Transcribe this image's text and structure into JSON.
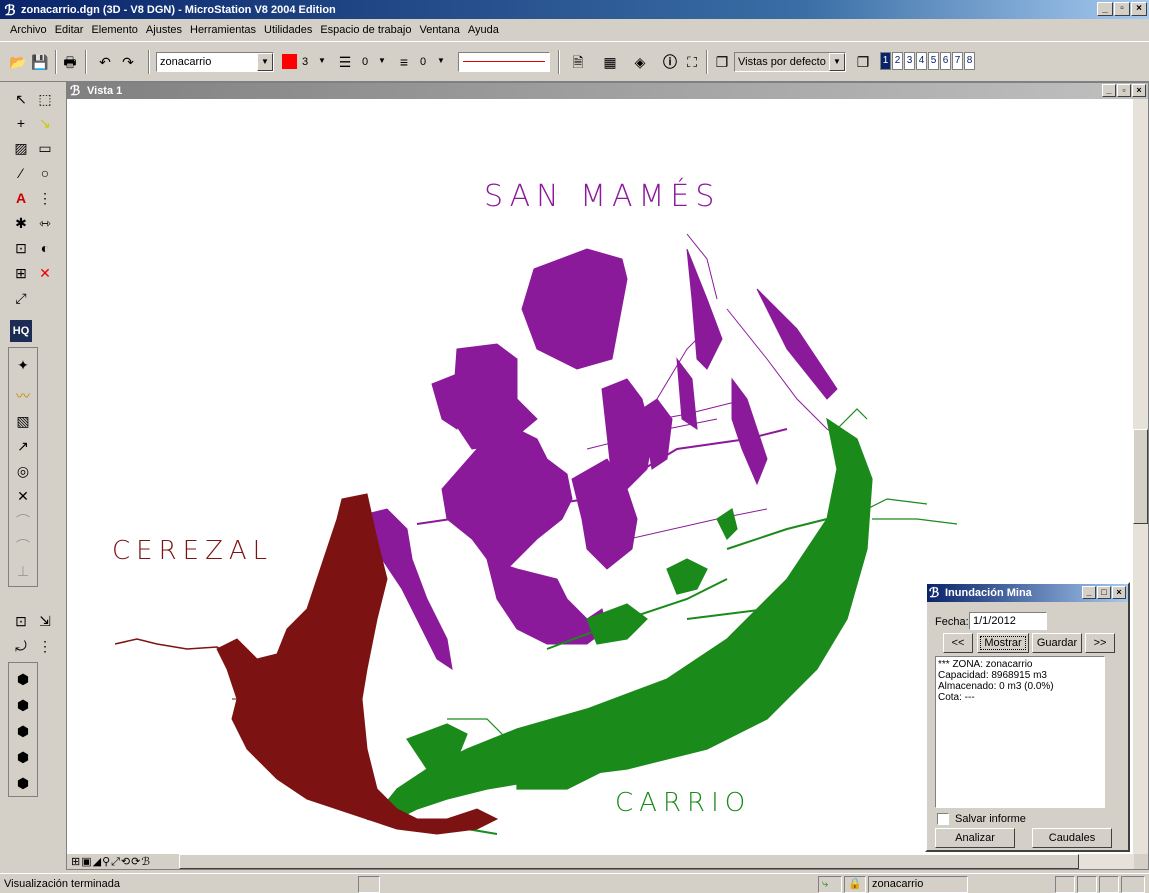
{
  "window": {
    "title": "zonacarrio.dgn (3D - V8 DGN) - MicroStation V8 2004 Edition",
    "app_icon": "microstation-logo-icon"
  },
  "menu": [
    "Archivo",
    "Editar",
    "Elemento",
    "Ajustes",
    "Herramientas",
    "Utilidades",
    "Espacio de trabajo",
    "Ventana",
    "Ayuda"
  ],
  "toolbar": {
    "level": "zonacarrio",
    "color_value": "3",
    "color_swatch": "#ff0000",
    "line_style_value": "0",
    "line_weight_value": "0",
    "views_combo": "Vistas por defecto",
    "view_numbers": [
      "1",
      "2",
      "3",
      "4",
      "5",
      "6",
      "7",
      "8"
    ]
  },
  "view": {
    "title": "Vista 1",
    "labels": {
      "san_mames": "SAN MAMÉS",
      "cerezal": "CEREZAL",
      "carrio": "CARRIO"
    },
    "colors": {
      "san_mames": "#8b1a9b",
      "cerezal": "#7d1212",
      "carrio": "#1a8a1a"
    }
  },
  "dialog": {
    "title": "Inundación Mina",
    "fecha_label": "Fecha:",
    "fecha_value": "1/1/2012",
    "prev_button": "<<",
    "mostrar_button": "Mostrar",
    "guardar_button": "Guardar",
    "next_button": ">>",
    "report_lines": [
      "*** ZONA: zonacarrio",
      "Capacidad: 8968915 m3",
      "Almacenado: 0 m3 (0.0%)",
      "Cota: ---"
    ],
    "salvar_label": "Salvar informe",
    "analizar_button": "Analizar",
    "caudales_button": "Caudales"
  },
  "status": {
    "message": "Visualización terminada",
    "model": "zonacarrio"
  }
}
